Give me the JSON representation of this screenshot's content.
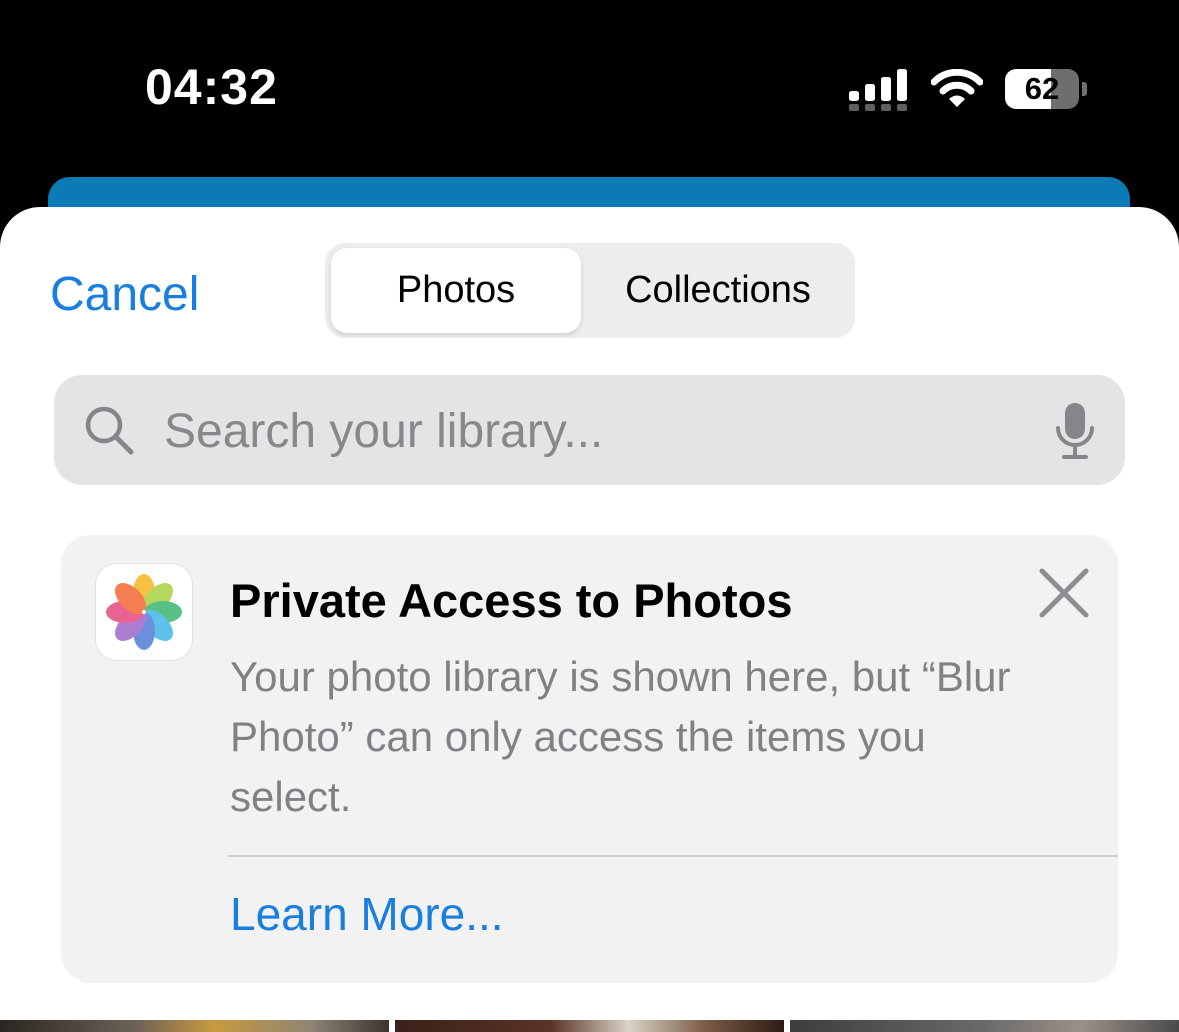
{
  "status_bar": {
    "time": "04:32",
    "battery_level": "62",
    "battery_fraction": 0.62,
    "icons": [
      "cellular-signal-icon",
      "wifi-icon",
      "battery-icon"
    ]
  },
  "sheet": {
    "cancel_label": "Cancel",
    "segments": [
      {
        "label": "Photos",
        "selected": true
      },
      {
        "label": "Collections",
        "selected": false
      }
    ],
    "search": {
      "placeholder": "Search your library...",
      "value": ""
    },
    "banner": {
      "title": "Private Access to Photos",
      "body": "Your photo library is shown here, but “Blur Photo” can only access the items you select.",
      "learn_more": "Learn More..."
    }
  },
  "colors": {
    "accent": "#1a7ee0",
    "background_card": "#0a7bb5",
    "banner_background": "#f2f2f3",
    "search_background": "#e4e4e6"
  }
}
